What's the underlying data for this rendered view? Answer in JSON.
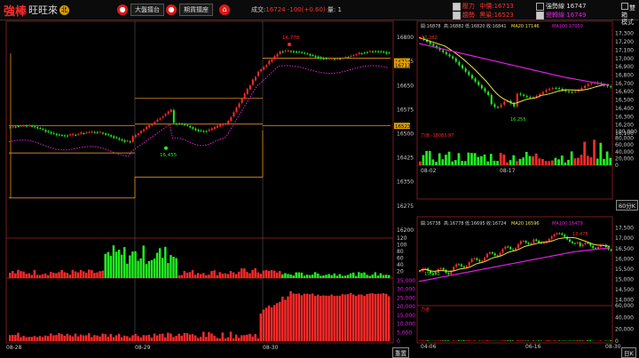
{
  "logo": {
    "main": "強棒",
    "sub": "旺旺來",
    "badge": "北"
  },
  "toolbar": {
    "market_btn": "大盤擂台",
    "futures_btn": "期貨擂座"
  },
  "quote": {
    "label": "成交:",
    "price": "16724",
    "change": "-100(+0.60)",
    "vol_label": "量:",
    "vol": "1"
  },
  "indicators": {
    "resist": {
      "label": "壓力",
      "name": "中價",
      "value": "16713"
    },
    "trend": {
      "label": "趨勢",
      "name": "黑粱",
      "value": "16523"
    },
    "strong": {
      "label": "強勢線",
      "value": "16747",
      "checked": false
    },
    "turn": {
      "label": "變轉線",
      "value": "16749",
      "checked": true
    }
  },
  "mode": {
    "label1": "雙箱",
    "label2": "模式"
  },
  "main_chart": {
    "y_ticks": [
      "16800",
      "16725",
      "16650",
      "16575",
      "16500",
      "16425",
      "16350",
      "16275",
      "16200"
    ],
    "price_tags": [
      "16724",
      "16713",
      "16523"
    ],
    "annot_high": "16,778",
    "annot_low": "16,455",
    "x_ticks": [
      "08-28",
      "08-29",
      "08-30"
    ],
    "vol1_ticks": [
      "120",
      "100",
      "80",
      "60",
      "40",
      "20"
    ],
    "vol2_ticks": [
      "35,000",
      "30,000",
      "25,000",
      "20,000",
      "15,000",
      "10,000",
      "5,000",
      "0"
    ],
    "reset_btn": "重置"
  },
  "right_top": {
    "info": {
      "open": "開:16878",
      "high": "高:16882",
      "low": "低:16820",
      "close": "收:16841",
      "ma20": "MA20 17146",
      "ma100": "MA100 17050"
    },
    "y_ticks": [
      "17,300",
      "17,200",
      "17,100",
      "17,000",
      "16,900",
      "16,800",
      "16,700",
      "16,600",
      "16,500",
      "16,400",
      "16,300",
      "16,200",
      "16,100"
    ],
    "annot_high": "17,282",
    "annot_low": "16,255",
    "vol_label": "力道:-18083.97",
    "vol_ticks": [
      "100,000",
      "80,000",
      "60,000",
      "40,000",
      "20,000",
      "0"
    ],
    "x_ticks": [
      "08-02",
      "08-17"
    ],
    "period_btn": "60分K"
  },
  "right_bottom": {
    "info": {
      "open": "開:16738",
      "high": "高:16778",
      "low": "低:16695",
      "close": "收:16724",
      "ma20": "MA20 16596",
      "ma100": "MA100 16479"
    },
    "y_ticks": [
      "17,500",
      "17,000",
      "16,500",
      "16,000",
      "15,500",
      "15,000",
      "14,500",
      "14,000"
    ],
    "annot_high": "17,475",
    "annot_low": "15,150",
    "vol_label": "力道",
    "vol_ticks": [
      "60,000",
      "40,000",
      "20,000",
      "0"
    ],
    "x_ticks": [
      "04-06",
      "06-16",
      "08-30"
    ],
    "period_btn": "日K"
  },
  "colors": {
    "up": "#ff2a2a",
    "down": "#22ee22",
    "ma_yellow": "#f0e040",
    "ma_magenta": "#e020e0",
    "border": "#7a1a1a",
    "orange": "#e8901c"
  }
}
